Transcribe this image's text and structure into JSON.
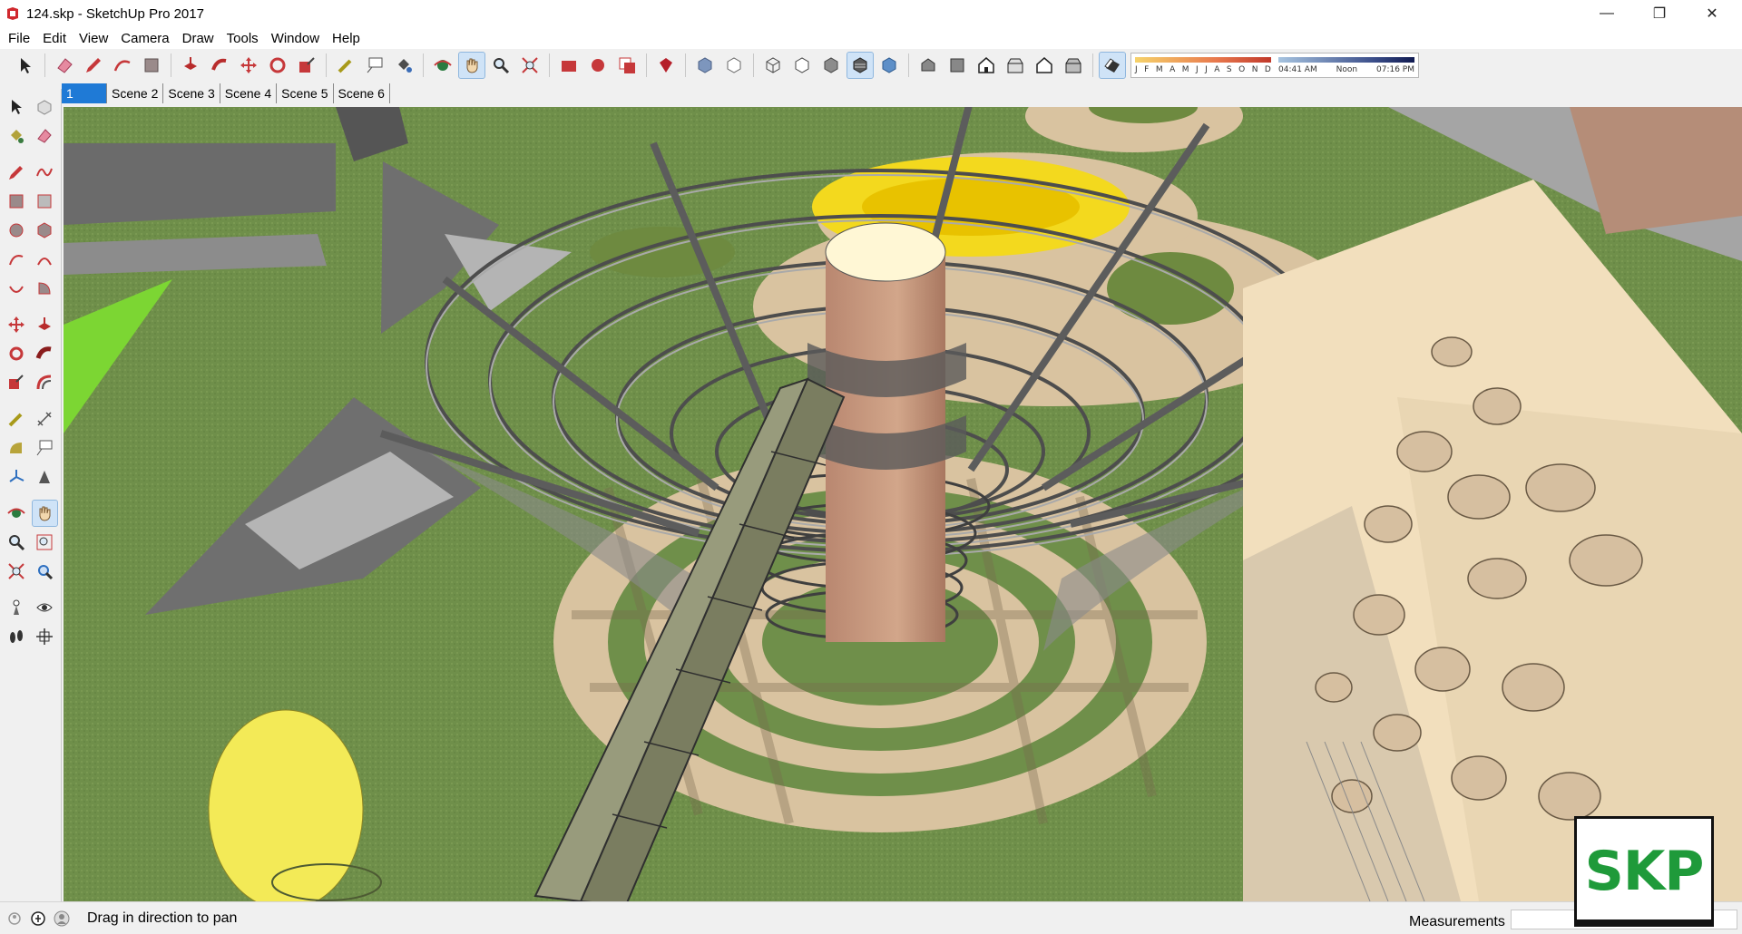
{
  "window": {
    "title": "124.skp - SketchUp Pro 2017",
    "minimize": "—",
    "maximize": "❐",
    "close": "✕"
  },
  "menu": [
    "File",
    "Edit",
    "View",
    "Camera",
    "Draw",
    "Tools",
    "Window",
    "Help"
  ],
  "shadow": {
    "months": [
      "J",
      "F",
      "M",
      "A",
      "M",
      "J",
      "J",
      "A",
      "S",
      "O",
      "N",
      "D"
    ],
    "time_start": "04:41 AM",
    "time_mid": "Noon",
    "time_end": "07:16 PM",
    "colors": {
      "months_gradient": [
        "#f6d36b",
        "#e8784d",
        "#c0392b"
      ],
      "time_gradient": [
        "#a7c4e0",
        "#3b4e8a",
        "#101a50"
      ]
    }
  },
  "scenes": [
    {
      "label": "1",
      "active": true
    },
    {
      "label": "Scene 2",
      "active": false
    },
    {
      "label": "Scene 3",
      "active": false
    },
    {
      "label": "Scene 4",
      "active": false
    },
    {
      "label": "Scene 5",
      "active": false
    },
    {
      "label": "Scene 6",
      "active": false
    }
  ],
  "status": {
    "hint": "Drag in direction to pan",
    "measurements_label": "Measurements",
    "measurements_value": ""
  },
  "watermark": {
    "text": "SKP"
  },
  "colors": {
    "accent": "#1f7ad6",
    "grass": "#6f8f4a",
    "paving": "#d9c3a0",
    "tower": "#c99a7e",
    "yellow": "#f3d91e"
  }
}
